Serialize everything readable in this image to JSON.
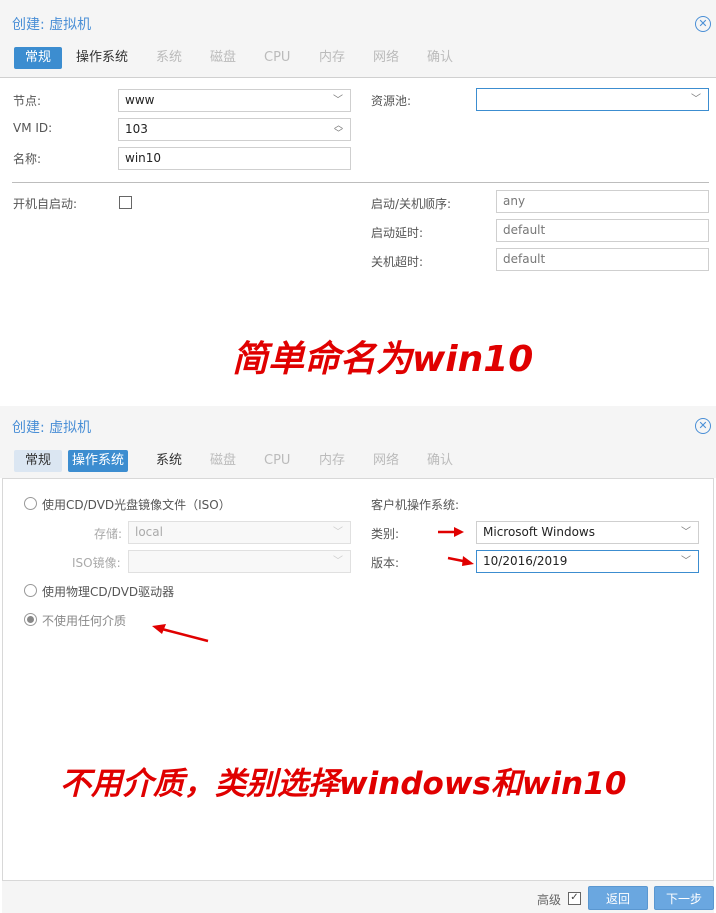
{
  "top": {
    "title": "创建: 虚拟机",
    "tabs": [
      "常规",
      "操作系统",
      "系统",
      "磁盘",
      "CPU",
      "内存",
      "网络",
      "确认"
    ],
    "fields": {
      "node_label": "节点:",
      "node_value": "www",
      "vmid_label": "VM ID:",
      "vmid_value": "103",
      "name_label": "名称:",
      "name_value": "win10",
      "pool_label": "资源池:",
      "pool_value": "",
      "autostart_label": "开机自启动:",
      "order_label": "启动/关机顺序:",
      "order_value": "any",
      "delay_label": "启动延时:",
      "delay_value": "default",
      "timeout_label": "关机超时:",
      "timeout_value": "default"
    },
    "annotation": "简单命名为win10"
  },
  "bottom": {
    "title": "创建: 虚拟机",
    "tabs": [
      "常规",
      "操作系统",
      "系统",
      "磁盘",
      "CPU",
      "内存",
      "网络",
      "确认"
    ],
    "media": {
      "iso_option": "使用CD/DVD光盘镜像文件（ISO）",
      "storage_label": "存储:",
      "storage_value": "local",
      "iso_label": "ISO镜像:",
      "iso_value": "",
      "physical_option": "使用物理CD/DVD驱动器",
      "none_option": "不使用任何介质"
    },
    "guest": {
      "heading": "客户机操作系统:",
      "type_label": "类别:",
      "type_value": "Microsoft Windows",
      "version_label": "版本:",
      "version_value": "10/2016/2019"
    },
    "annotation": "不用介质，类别选择windows和win10",
    "footer": {
      "advanced_label": "高级",
      "back_label": "返回",
      "next_label": "下一步"
    }
  },
  "icons": [
    "close-icon",
    "chevron-down-icon",
    "spinner-icon",
    "checkbox",
    "red-arrow-icon"
  ],
  "colors": {
    "accent": "#3c8dd0",
    "annotation": "#e00000"
  }
}
